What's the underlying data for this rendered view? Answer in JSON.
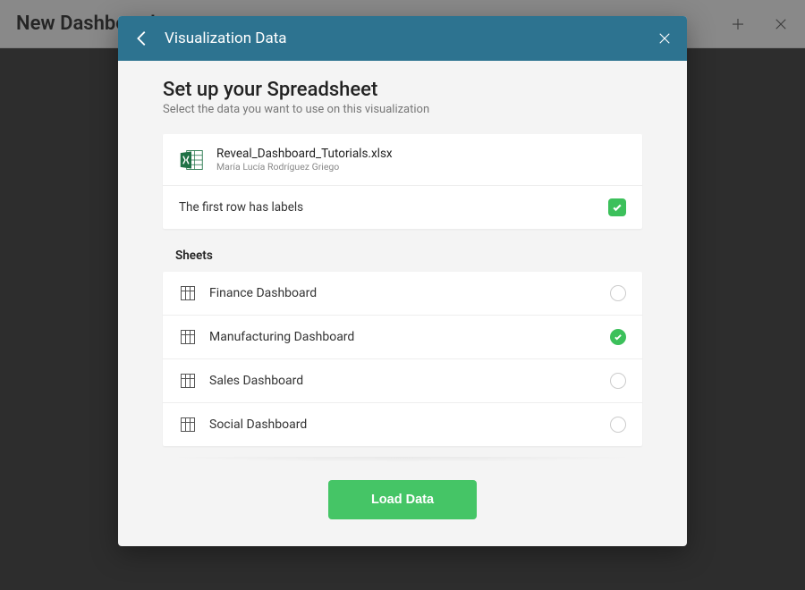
{
  "backdrop": {
    "title": "New Dashboard"
  },
  "modal": {
    "header_title": "Visualization Data",
    "setup_title": "Set up your Spreadsheet",
    "setup_subtitle": "Select the data you want to use on this visualization",
    "file": {
      "name": "Reveal_Dashboard_Tutorials.xlsx",
      "owner": "María Lucía Rodríguez Griego"
    },
    "first_row_labels_text": "The first row has labels",
    "first_row_labels_checked": true,
    "sheets_label": "Sheets",
    "sheets": [
      {
        "name": "Finance Dashboard",
        "selected": false
      },
      {
        "name": "Manufacturing Dashboard",
        "selected": true
      },
      {
        "name": "Sales Dashboard",
        "selected": false
      },
      {
        "name": "Social Dashboard",
        "selected": false
      }
    ],
    "load_button": "Load Data"
  },
  "colors": {
    "header": "#2d7390",
    "accent_green": "#3cc05b"
  }
}
